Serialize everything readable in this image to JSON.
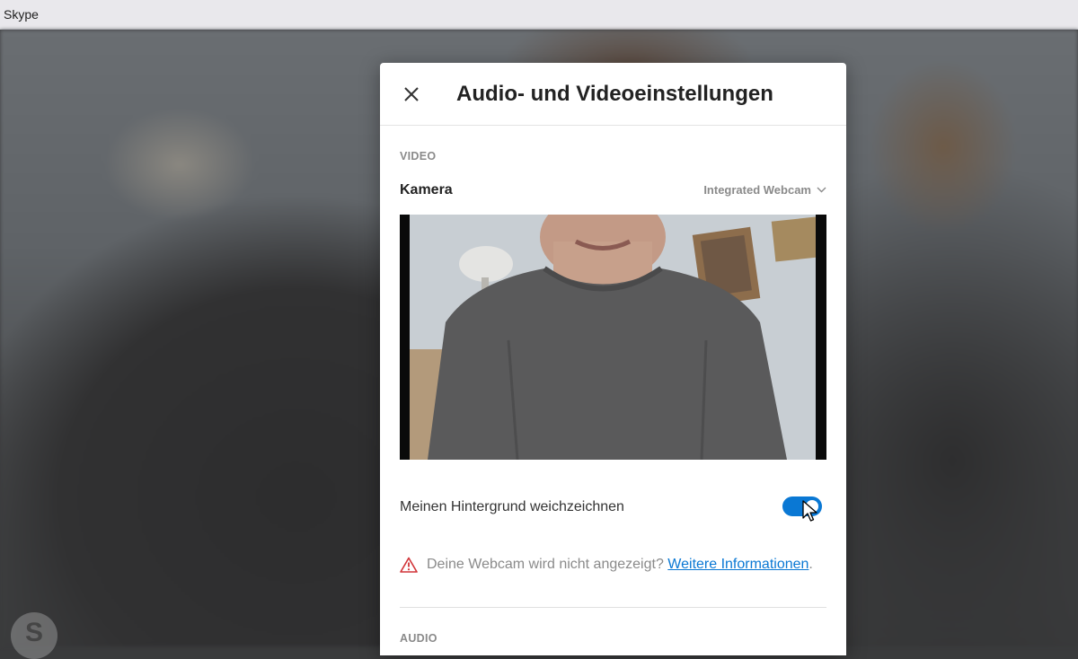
{
  "window": {
    "title": "Skype"
  },
  "background": {
    "logo_letter": "S"
  },
  "dialog": {
    "title": "Audio- und Videoeinstellungen",
    "close_icon": "close-icon",
    "video": {
      "section_label": "VIDEO",
      "camera_label": "Kamera",
      "camera_selected": "Integrated Webcam",
      "blur_label": "Meinen Hintergrund weichzeichnen",
      "blur_enabled": true,
      "warning_text": "Deine Webcam wird nicht angezeigt?",
      "warning_link": "Weitere Informationen",
      "warning_suffix": "."
    },
    "audio": {
      "section_label": "AUDIO"
    }
  },
  "colors": {
    "accent": "#0a78d4",
    "warning": "#d13438",
    "muted_text": "#8a8a8a"
  }
}
